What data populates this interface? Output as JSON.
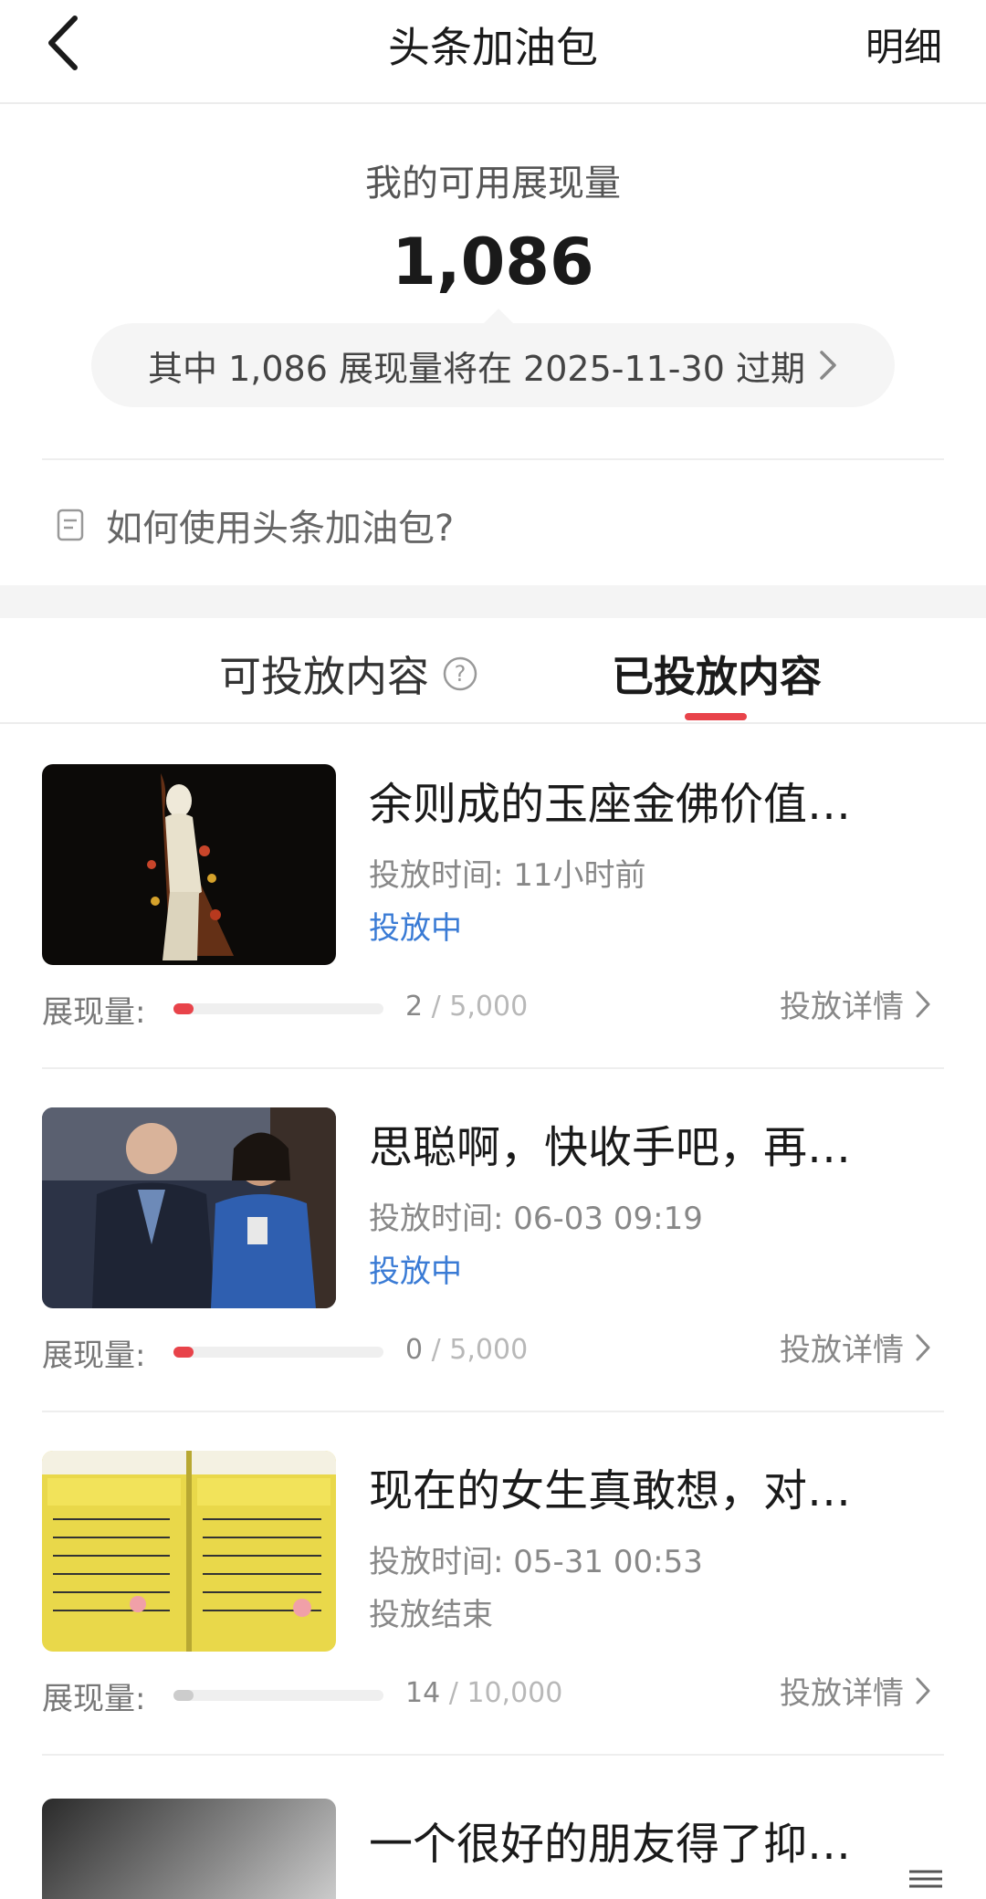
{
  "header": {
    "title": "头条加油包",
    "detail_label": "明细"
  },
  "summary": {
    "available_label": "我的可用展现量",
    "available_value": "1,086",
    "expire_notice": "其中 1,086 展现量将在 2025-11-30 过期",
    "howto_label": "如何使用头条加油包?"
  },
  "tabs": [
    {
      "label": "可投放内容"
    },
    {
      "label": "已投放内容",
      "selected": true
    }
  ],
  "accent_color": "#e8434a",
  "items": [
    {
      "title": "余则成的玉座金佛价值…",
      "time": "投放时间: 11小时前",
      "status": "投放中",
      "impressions_label": "展现量:",
      "current": "2",
      "total": " / 5,000",
      "progress": 0.0004,
      "bar_color": "#e8434a",
      "detail_label": "投放详情",
      "thumb_icon": "jade-buddha-statue-photo"
    },
    {
      "title": "思聪啊，快收手吧，再…",
      "time": "投放时间: 06-03 09:19",
      "status": "投放中",
      "impressions_label": "展现量:",
      "current": "0",
      "total": " / 5,000",
      "progress": 0,
      "bar_color": "#e8434a",
      "detail_label": "投放详情",
      "thumb_icon": "people-photo"
    },
    {
      "title": "现在的女生真敢想，对…",
      "time": "投放时间: 05-31 00:53",
      "status": "投放结束",
      "impressions_label": "展现量:",
      "current": "14",
      "total": " / 10,000",
      "progress": 0.0014,
      "bar_color": "#cccccc",
      "detail_label": "投放详情",
      "thumb_icon": "yellow-posters-photo"
    }
  ],
  "partial_item": {
    "title": "一个很好的朋友得了抑…"
  }
}
